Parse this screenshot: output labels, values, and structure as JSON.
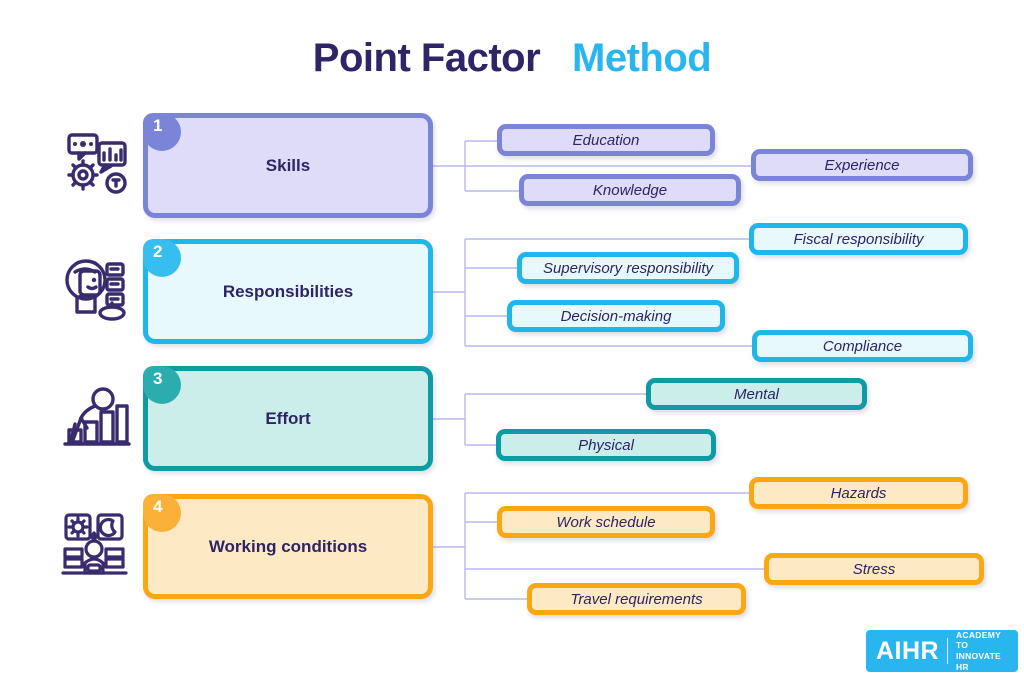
{
  "title": {
    "part1": "Point Factor",
    "part2": "Method",
    "color_dark": "#2e2466",
    "color_blue": "#29b6ef"
  },
  "colors": {
    "background": "#ffffff",
    "text_dark": "#2e2466",
    "connector": "#b9b8ee",
    "icon": "#3a2b6e"
  },
  "rows": [
    {
      "number": "1",
      "label": "Skills",
      "icon": "gear-chart-icon",
      "border_color": "#7b85d8",
      "fill_color": "#dedcf8",
      "badge_color": "#7b85d8",
      "sub_items": [
        {
          "label": "Education"
        },
        {
          "label": "Experience"
        },
        {
          "label": "Knowledge"
        }
      ]
    },
    {
      "number": "2",
      "label": "Responsibilities",
      "icon": "person-checklist-icon",
      "border_color": "#1fb6ea",
      "fill_color": "#e8f9fd",
      "badge_color": "#38bdf0",
      "sub_items": [
        {
          "label": "Fiscal responsibility"
        },
        {
          "label": "Supervisory responsibility"
        },
        {
          "label": "Decision-making"
        },
        {
          "label": "Compliance"
        }
      ]
    },
    {
      "number": "3",
      "label": "Effort",
      "icon": "person-climbing-bars-icon",
      "border_color": "#0f9ba4",
      "fill_color": "#cceeea",
      "badge_color": "#2badb0",
      "sub_items": [
        {
          "label": "Mental"
        },
        {
          "label": "Physical"
        }
      ]
    },
    {
      "number": "4",
      "label": "Working conditions",
      "icon": "workspace-day-night-icon",
      "border_color": "#faa712",
      "fill_color": "#fde9c4",
      "badge_color": "#fbb038",
      "sub_items": [
        {
          "label": "Hazards"
        },
        {
          "label": "Work schedule"
        },
        {
          "label": "Stress"
        },
        {
          "label": "Travel requirements"
        }
      ]
    }
  ],
  "logo": {
    "mark": "AIHR",
    "tagline_line1": "ACADEMY TO",
    "tagline_line2": "INNOVATE HR",
    "background": "#29b6ef"
  }
}
